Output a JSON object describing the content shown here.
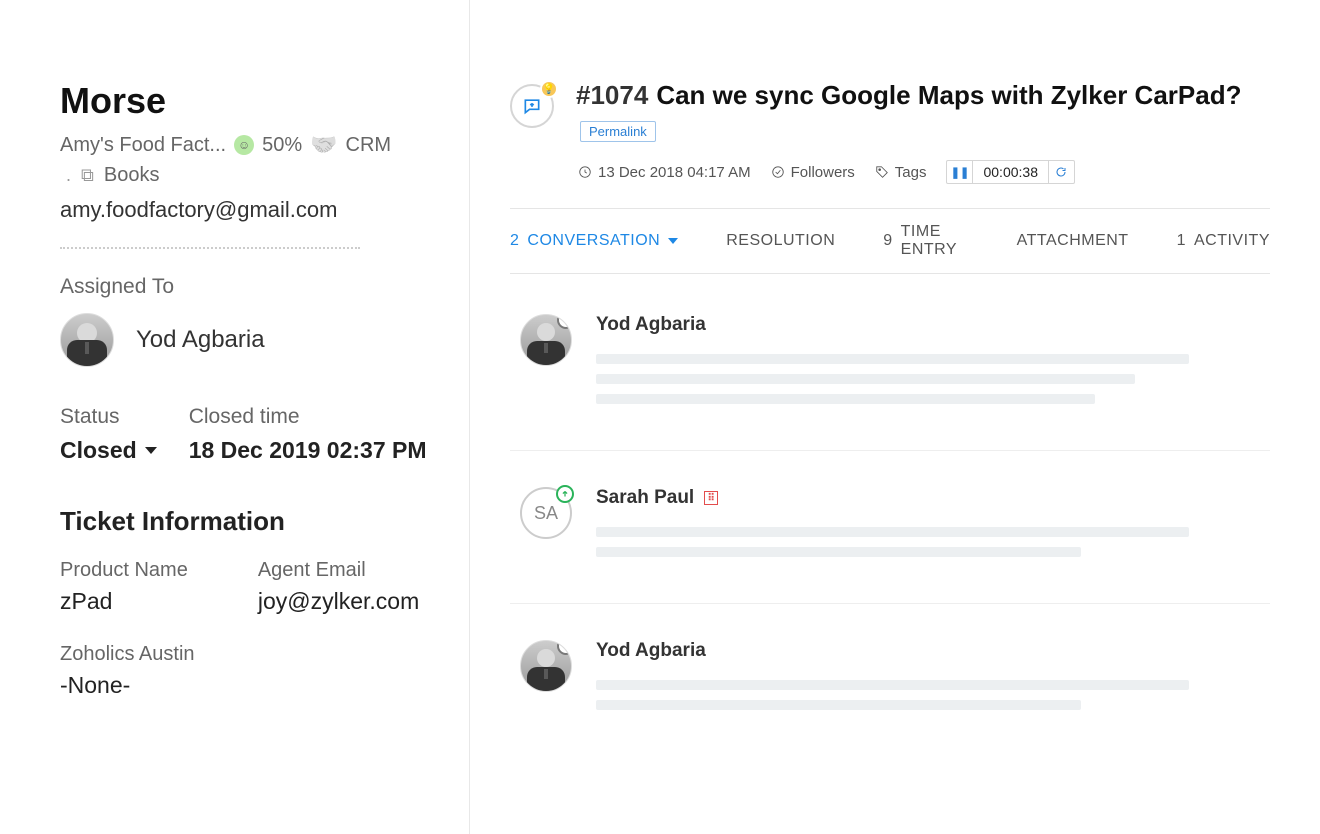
{
  "contact": {
    "name": "Morse",
    "company": "Amy's Food Fact...",
    "happiness_percent": "50%",
    "crm_label": "CRM",
    "books_label": "Books",
    "email": "amy.foodfactory@gmail.com"
  },
  "assignment": {
    "label": "Assigned To",
    "assignee_name": "Yod Agbaria"
  },
  "status": {
    "label": "Status",
    "value": "Closed"
  },
  "closed_time": {
    "label": "Closed time",
    "value": "18 Dec 2019 02:37 PM"
  },
  "ticket_info": {
    "heading": "Ticket Information",
    "product_name": {
      "label": "Product Name",
      "value": "zPad"
    },
    "agent_email": {
      "label": "Agent Email",
      "value": "joy@zylker.com"
    },
    "zoholics": {
      "label": "Zoholics Austin",
      "value": "-None-"
    }
  },
  "ticket": {
    "number": "#1074",
    "subject": "Can we sync Google Maps with Zylker CarPad?",
    "permalink_label": "Permalink",
    "created": "13 Dec 2018 04:17 AM",
    "followers_label": "Followers",
    "tags_label": "Tags",
    "timer": "00:00:38"
  },
  "tabs": {
    "conversation": {
      "count": "2",
      "label": "CONVERSATION"
    },
    "resolution": {
      "label": "RESOLUTION"
    },
    "time_entry": {
      "count": "9",
      "label": "TIME ENTRY"
    },
    "attachment": {
      "label": "ATTACHMENT"
    },
    "activity": {
      "count": "1",
      "label": "ACTIVITY"
    }
  },
  "threads": [
    {
      "author": "Yod Agbaria",
      "avatar_type": "person",
      "badge": "blue",
      "lines": 3,
      "widths": [
        "88%",
        "80%",
        "74%"
      ]
    },
    {
      "author": "Sarah Paul",
      "initials": "SA",
      "avatar_type": "initials",
      "badge": "green",
      "warn": true,
      "lines": 2,
      "widths": [
        "88%",
        "72%"
      ]
    },
    {
      "author": "Yod Agbaria",
      "avatar_type": "person",
      "badge": "blue",
      "lines": 2,
      "widths": [
        "88%",
        "72%"
      ]
    }
  ]
}
